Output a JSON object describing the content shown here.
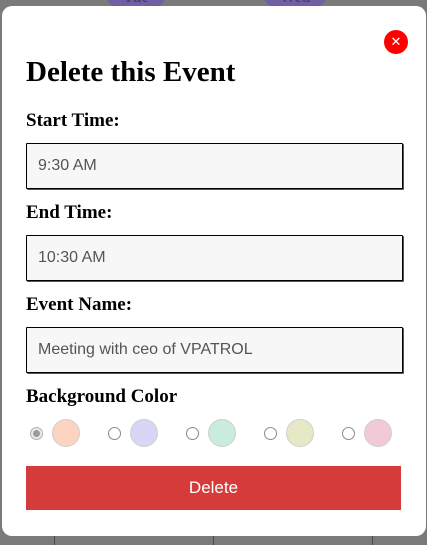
{
  "background": {
    "day_labels": [
      "Tue",
      "Wed"
    ]
  },
  "modal": {
    "title": "Delete this Event",
    "close_icon": "close-icon",
    "close_glyph": "✕",
    "start_time": {
      "label": "Start Time:",
      "value": "9:30 AM"
    },
    "end_time": {
      "label": "End Time:",
      "value": "10:30 AM"
    },
    "event_name": {
      "label": "Event Name:",
      "value": "Meeting with ceo of VPATROL"
    },
    "background_color": {
      "label": "Background Color",
      "selected_index": 0,
      "options": [
        "#fdd3c2",
        "#d7d6f6",
        "#c9ecdc",
        "#e6e8c6",
        "#f0cad7"
      ]
    },
    "delete_label": "Delete",
    "colors": {
      "close": "#ff0000",
      "delete": "#d63b3b"
    }
  }
}
